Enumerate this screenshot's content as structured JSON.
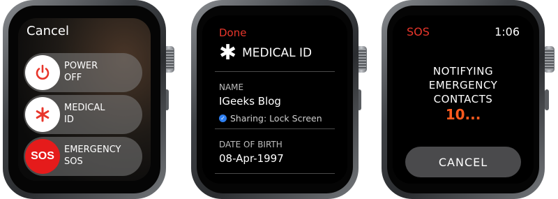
{
  "watch_power": {
    "cancel_label": "Cancel",
    "sliders": [
      {
        "label_line1": "POWER",
        "label_line2": "OFF",
        "icon": "power-icon"
      },
      {
        "label_line1": "MEDICAL",
        "label_line2": "ID",
        "icon": "asterisk-icon"
      },
      {
        "label_line1": "EMERGENCY",
        "label_line2": "SOS",
        "icon": "sos-icon",
        "knob_text": "SOS"
      }
    ]
  },
  "watch_medical": {
    "done_label": "Done",
    "title": "MEDICAL ID",
    "name_label": "NAME",
    "name_value": "IGeeks Blog",
    "sharing_text": "Sharing: Lock Screen",
    "dob_label": "DATE OF BIRTH",
    "dob_value": "08-Apr-1997"
  },
  "watch_sos": {
    "sos_label": "SOS",
    "time": "1:06",
    "message_line1": "NOTIFYING",
    "message_line2": "EMERGENCY",
    "message_line3": "CONTACTS",
    "countdown": "10...",
    "cancel_label": "CANCEL"
  },
  "colors": {
    "accent_red": "#e8362b",
    "countdown_orange": "#ff5a1e",
    "sos_knob": "#e51b1b",
    "check_blue": "#2e7ff0"
  }
}
